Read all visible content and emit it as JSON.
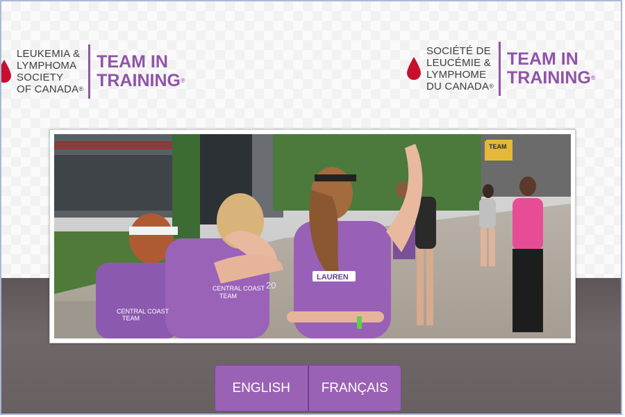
{
  "header": {
    "logo_en": {
      "org_lines": [
        "LEUKEMIA &",
        "LYMPHOMA",
        "SOCIETY",
        "OF CANADA"
      ],
      "org_mark": "®",
      "title_lines": [
        "TEAM IN",
        "TRAINING"
      ],
      "title_mark": "®"
    },
    "logo_fr": {
      "org_lines": [
        "SOCIÉTÉ DE",
        "LEUCÉMIE &",
        "LYMPHOME",
        "DU CANADA"
      ],
      "org_mark": "®",
      "title_lines": [
        "TEAM IN",
        "TRAINING"
      ],
      "title_mark": "®"
    }
  },
  "photo": {
    "shirt_texts": [
      "CENTRAL COAST",
      "TEAM",
      "LAUREN",
      "20"
    ],
    "banner": "TEAM"
  },
  "language": {
    "english_label": "ENGLISH",
    "french_label": "FRANÇAIS"
  },
  "colors": {
    "brand_purple": "#8f54a8",
    "button_purple": "#9a62b4",
    "drop_red": "#c8102e",
    "footer_gray": "#6f6768"
  }
}
